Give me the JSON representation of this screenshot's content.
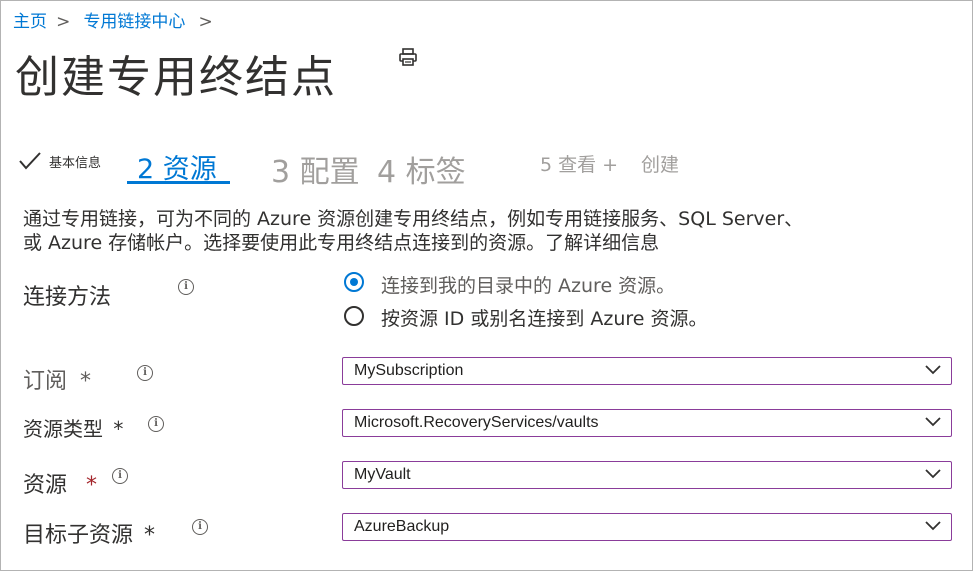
{
  "breadcrumb": {
    "home": "主页",
    "sep1": ">",
    "hub": "专用链接中心",
    "sep2": ">"
  },
  "page": {
    "title": "创建专用终结点"
  },
  "steps": [
    {
      "label": "基本信息",
      "state": "done"
    },
    {
      "label": "2 资源",
      "state": "active"
    },
    {
      "label": "3 配置",
      "state": "todo"
    },
    {
      "label": "4 标签",
      "state": "todo"
    },
    {
      "label": "5 查看 +",
      "state": "todo"
    },
    {
      "label": "创建",
      "state": "todo"
    }
  ],
  "description": {
    "line1": "通过专用链接，可为不同的 Azure 资源创建专用终结点，例如专用链接服务、SQL Server、",
    "line2": "或 Azure 存储帐户。选择要使用此专用终结点连接到的资源。了解详细信息"
  },
  "connection": {
    "label": "连接方法",
    "options": [
      {
        "label": "连接到我的目录中的 Azure 资源。",
        "selected": true
      },
      {
        "label": "按资源 ID 或别名连接到 Azure 资源。",
        "selected": false
      }
    ]
  },
  "fields": {
    "subscription": {
      "label": "订阅",
      "required": "*",
      "value": "MySubscription"
    },
    "resource_type": {
      "label": "资源类型",
      "required": "*",
      "value": "Microsoft.RecoveryServices/vaults"
    },
    "resource": {
      "label": "资源",
      "required": "*",
      "value": "MyVault"
    },
    "target_subresource": {
      "label": "目标子资源",
      "required": "*",
      "value": "AzureBackup"
    }
  },
  "colors": {
    "accent": "#0078d4",
    "focus_border": "#8a3c9a",
    "required": "#a4262c"
  }
}
